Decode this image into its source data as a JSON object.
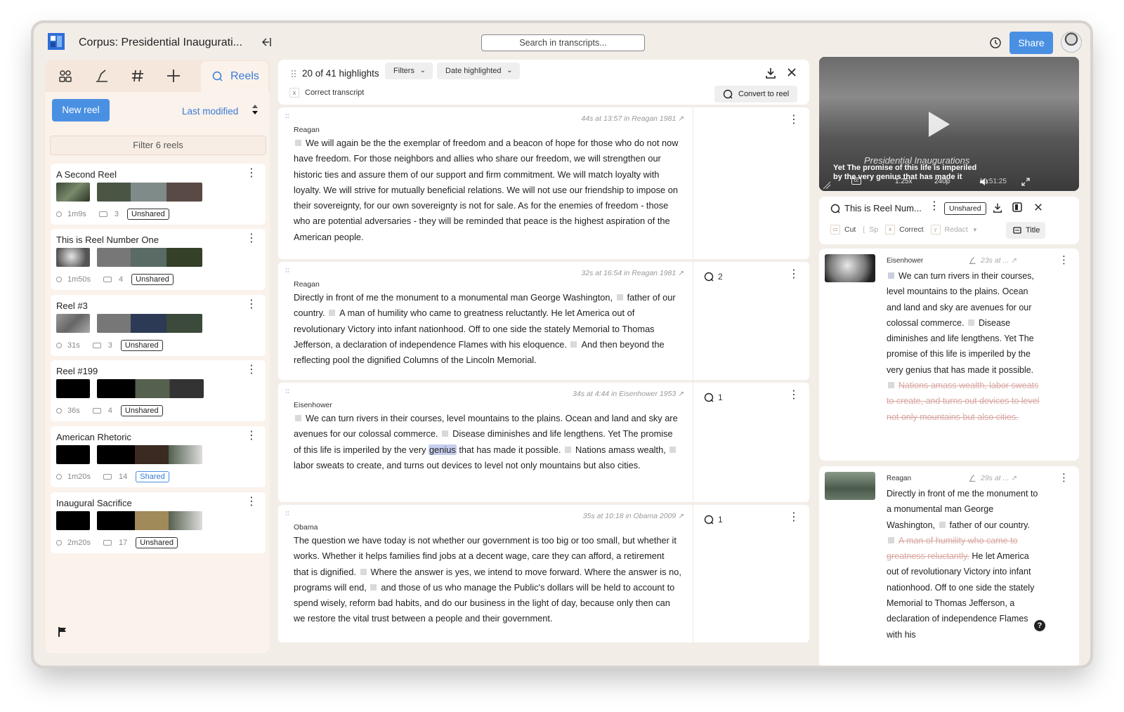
{
  "app": {
    "title": "Corpus: Presidential Inaugurati...",
    "search_placeholder": "Search in transcripts...",
    "share_label": "Share",
    "accent": "#4a90e2"
  },
  "left": {
    "tabs": [
      "people-icon",
      "highlighter-icon",
      "tag-icon",
      "add-icon"
    ],
    "active_tab_label": "Reels",
    "new_reel_label": "New reel",
    "sort_label": "Last modified",
    "filter_label": "Filter 6 reels",
    "reels": [
      {
        "title": "A Second Reel",
        "duration": "1m9s",
        "clips": "3",
        "status": "Unshared"
      },
      {
        "title": "This is Reel Number One",
        "duration": "1m50s",
        "clips": "4",
        "status": "Unshared"
      },
      {
        "title": "Reel #3",
        "duration": "31s",
        "clips": "3",
        "status": "Unshared"
      },
      {
        "title": "Reel #199",
        "duration": "36s",
        "clips": "4",
        "status": "Unshared"
      },
      {
        "title": "American Rhetoric",
        "duration": "1m20s",
        "clips": "14",
        "status": "Shared"
      },
      {
        "title": "Inaugural Sacrifice",
        "duration": "2m20s",
        "clips": "17",
        "status": "Unshared"
      }
    ]
  },
  "middle": {
    "count_label": "20 of 41 highlights",
    "filters_label": "Filters",
    "date_label": "Date highlighted",
    "correct_chip": "Correct transcript",
    "convert_label": "Convert to reel",
    "highlights": [
      {
        "meta": "44s at 13:57 in Reagan 1981 ↗",
        "speaker": "Reagan",
        "comments": "",
        "p1": "We will again be the the exemplar of freedom and a beacon of hope for those who do not now have freedom. For those neighbors and allies who share our freedom, we will strengthen our historic ties and assure them of our support and firm commitment. We will match loyalty with loyalty. We will strive for mutually beneficial relations. We will not use our friendship to impose on their sovereignty, for our own sovereignty is not for sale. As for the enemies of freedom - those who are potential adversaries - they will be reminded that peace is the highest aspiration of the American people."
      },
      {
        "meta": "32s at 16:54 in Reagan 1981 ↗",
        "speaker": "Reagan",
        "comments": "2",
        "p1": "Directly in front of me the monument to a monumental man George Washington,",
        "p2": "father of our country.",
        "p3": "A man of humility who came to greatness reluctantly. He let America out of revolutionary Victory into infant nationhood. Off to one side the stately Memorial to Thomas Jefferson, a declaration of independence Flames with his eloquence.",
        "p4": "And then beyond the reflecting pool the dignified Columns of the Lincoln Memorial."
      },
      {
        "meta": "34s at 4:44 in Eisenhower 1953 ↗",
        "speaker": "Eisenhower",
        "comments": "1",
        "p1": "We can turn rivers in their courses, level mountains to the plains. Ocean and land and sky are avenues for our colossal commerce.",
        "p2": "Disease diminishes and life lengthens. Yet The promise of this life is imperiled by the very",
        "mark": "genius",
        "p3": "that has made it possible.",
        "p4": "Nations amass wealth,",
        "p5": "labor sweats to create, and turns out devices to level not only mountains but also cities."
      },
      {
        "meta": "35s at 10:18 in Obama 2009 ↗",
        "speaker": "Obama",
        "comments": "1",
        "p1": "The question we have today is not whether our government is too big or too small, but whether it works. Whether it helps families find jobs at a decent wage, care they can afford, a retirement that is dignified.",
        "p2": "Where the answer is yes, we intend to move forward. Where the answer is no, programs will end,",
        "p3": "and those of us who manage the Public's dollars will be held to account to spend wisely, reform bad habits, and do our business in the light of day, because only then can we restore the vital trust between a people and their government."
      }
    ]
  },
  "video": {
    "overlay_title": "Presidential Inaugurations",
    "caption_line1": "Yet The promise of this life is imperiled",
    "caption_line2": "by the very genius that has made it",
    "speed": "1.25x",
    "quality": "240p",
    "time": "10:51:25"
  },
  "reel": {
    "title": "This is Reel Num...",
    "status": "Unshared",
    "tools": [
      "Cut",
      "Sp",
      "Correct",
      "Redact"
    ],
    "title_btn": "Title",
    "clips": [
      {
        "speaker": "Eisenhower",
        "meta": "23s at ... ↗",
        "t1": "We can turn rivers in their courses, level mountains to the plains. Ocean and land and sky are avenues for our colossal commerce.",
        "t2": "Disease diminishes and life lengthens. Yet The promise of this life is imperiled by the very genius that has made it possible.",
        "strike": "Nations amass wealth, labor sweats to create, and turns out devices to level not only mountains but also cities."
      },
      {
        "speaker": "Reagan",
        "meta": "29s at ... ↗",
        "t1": "Directly in front of me the monument to a monumental man George Washington,",
        "t2": "father of our country.",
        "strike": "A man of humility who came to greatness reluctantly.",
        "t3": "He let America out of revolutionary Victory into infant nationhood. Off to one side the stately Memorial to Thomas Jefferson, a declaration of independence Flames with his"
      }
    ]
  }
}
